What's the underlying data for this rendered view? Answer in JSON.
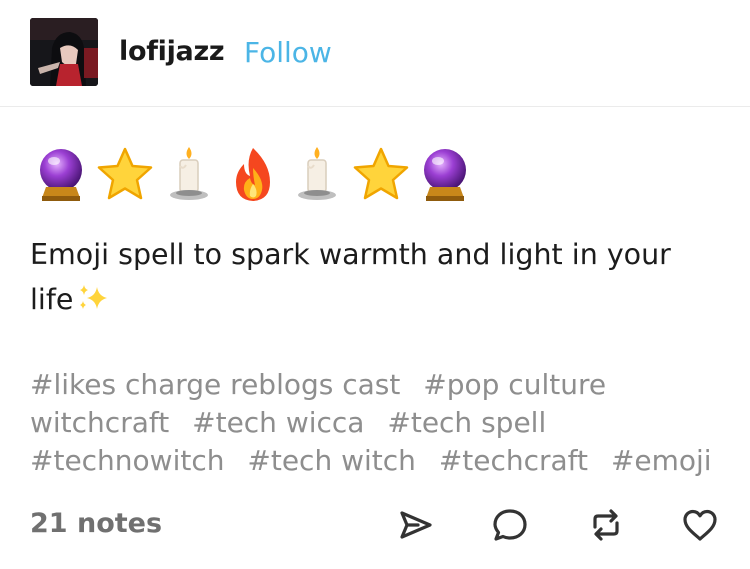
{
  "post": {
    "author": "lofijazz",
    "follow_label": "Follow",
    "emoji_sequence": [
      "crystal-ball",
      "star",
      "candle",
      "fire",
      "candle",
      "star",
      "crystal-ball"
    ],
    "caption_text": "Emoji spell to spark warmth and light in your life",
    "caption_emoji": "sparkles",
    "tags": [
      "#likes charge reblogs cast",
      "#pop culture witchcraft",
      "#tech wicca",
      "#tech spell",
      "#technowitch",
      "#tech witch",
      "#techcraft",
      "#emoji"
    ],
    "notes_label": "21 notes"
  },
  "actions": {
    "share_icon": "paper-plane-icon",
    "reply_icon": "speech-bubble-icon",
    "reblog_icon": "reblog-icon",
    "like_icon": "heart-icon"
  },
  "colors": {
    "follow": "#4bb5e6",
    "tags": "#8e8e8e",
    "notes": "#707070",
    "icons": "#333333"
  }
}
